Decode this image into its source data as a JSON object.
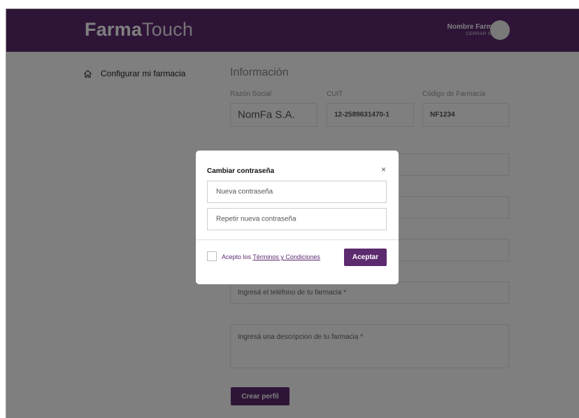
{
  "header": {
    "logo_bold": "Farma",
    "logo_light": "Touch",
    "user_name": "Nombre Farmacia",
    "logout_label": "CERRAR SESIÓN"
  },
  "sidebar": {
    "items": [
      {
        "label": "Configurar mi farmacia",
        "icon": "home-icon"
      }
    ]
  },
  "main": {
    "title": "Información",
    "fields": {
      "razon_social": {
        "label": "Razón Social",
        "value": "NomFa S.A."
      },
      "cuit": {
        "label": "CUIT",
        "value": "12-2589631470-1"
      },
      "codigo": {
        "label": "Código de Farmacia",
        "value": "NF1234"
      }
    },
    "phone_placeholder": "Ingresá el teléfono de tu farmacia *",
    "description_placeholder": "Ingresá una descripcion de tu farmacia *",
    "create_button": "Crear perfil"
  },
  "modal": {
    "title": "Cambiar contraseña",
    "close_symbol": "×",
    "new_password_placeholder": "Nueva contraseña",
    "repeat_password_placeholder": "Repetir nueva contraseña",
    "terms_prefix": "Acepto los ",
    "terms_link": "Términos y Condiciones",
    "accept_button": "Aceptar"
  },
  "colors": {
    "brand": "#5c2a6e"
  }
}
